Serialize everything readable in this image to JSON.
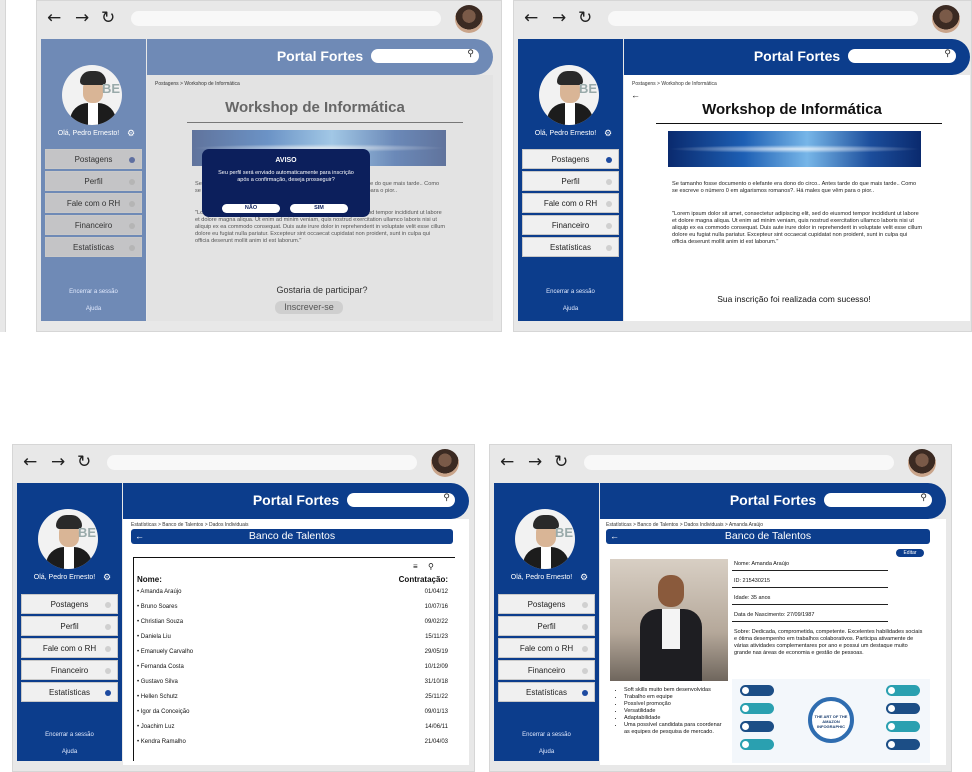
{
  "app": {
    "title": "Portal Fortes",
    "greeting": "Olá, Pedro Ernesto!",
    "menu": [
      "Postagens",
      "Perfil",
      "Fale com o RH",
      "Financeiro",
      "Estatísticas"
    ],
    "logout": "Encerrar a sessão",
    "help": "Ajuda",
    "avatar_logo": "BE"
  },
  "icons": {
    "back": "←",
    "forward": "→",
    "reload": "↻",
    "search": "⚲",
    "gear": "⚙",
    "back_small": "🡐",
    "menu": "≡"
  },
  "colors": {
    "brand": "#0c3d8c",
    "modal": "#0c1f5c",
    "dimmed": "#6f8ab6"
  },
  "workshop": {
    "breadcrumb": "Postagens > Workshop de Informática",
    "title": "Workshop de Informática",
    "para1": "Se tamanho fosse documento o elefante era dono do circo.. Antes tarde do que mais tarde.. Como se escreve o número 0 em algarismos romanos?. Há males que vêm para o pior..",
    "para2": "\"Lorem ipsum dolor sit amet, consectetur adipiscing elit, sed do eiusmod tempor incididunt ut labore et dolore magna aliqua. Ut enim ad minim veniam, quis nostrud exercitation ullamco laboris nisi ut aliquip ex ea commodo consequat. Duis aute irure dolor in reprehenderit in voluptate velit esse cillum dolore eu fugiat nulla pariatur. Excepteur sint occaecat cupidatat non proident, sunt in culpa qui officia deserunt mollit anim id est laborum.\"",
    "question": "Gostaria de participar?",
    "enroll": "Inscrever-se",
    "success": "Sua inscrição foi realizada com sucesso!"
  },
  "modal": {
    "title": "AVISO",
    "text": "Seu perfil será enviado automaticamente para inscrição após a confirmação, deseja prosseguir?",
    "no": "NÃO",
    "yes": "SIM"
  },
  "talents": {
    "breadcrumb": "Estatísticas > Banco de Talentos > Dados Individuais",
    "title": "Banco de Talentos",
    "col_name": "Nome:",
    "col_date": "Contratação:",
    "rows": [
      {
        "name": "Amanda Araújo",
        "date": "01/04/12"
      },
      {
        "name": "Bruno Soares",
        "date": "10/07/16"
      },
      {
        "name": "Christian Souza",
        "date": "09/02/22"
      },
      {
        "name": "Daniela Liu",
        "date": "15/11/23"
      },
      {
        "name": "Emanuely Carvalho",
        "date": "29/05/19"
      },
      {
        "name": "Fernanda Costa",
        "date": "10/12/09"
      },
      {
        "name": "Gustavo Silva",
        "date": "31/10/18"
      },
      {
        "name": "Hellen Schutz",
        "date": "25/11/22"
      },
      {
        "name": "Igor da Conceição",
        "date": "09/01/13"
      },
      {
        "name": "Joachim Luz",
        "date": "14/06/11"
      },
      {
        "name": "Kendra Ramalho",
        "date": "21/04/03"
      }
    ]
  },
  "profile": {
    "breadcrumb": "Estatísticas > Banco de Talentos > Dados Individuais > Amanda Araújo",
    "edit": "Editar",
    "fields": [
      "Nome: Amanda Araújo",
      "ID: 215430215",
      "Idade: 35 anos",
      "Data de Nascimento: 27/09/1987"
    ],
    "about": "Sobre: Dedicada, comprometida, competente. Excelentes habilidades sociais e ótima desempenho em trabalhos colaborativos. Participa ativamente de várias atividades complementares por ano e possui um destaque muito grande nas áreas de economia e gestão de pessoas.",
    "skills": [
      "Soft skills muito bem desenvolvidas",
      "Trabalho em equipe",
      "Possível promoção",
      "Versatilidade",
      "Adaptabilidade",
      "Uma possível candidata para coordenar as equipes de pesquisa de mercado."
    ],
    "infographic_title": "THE ART OF THE AMAZON INFOGRAPHIC"
  }
}
